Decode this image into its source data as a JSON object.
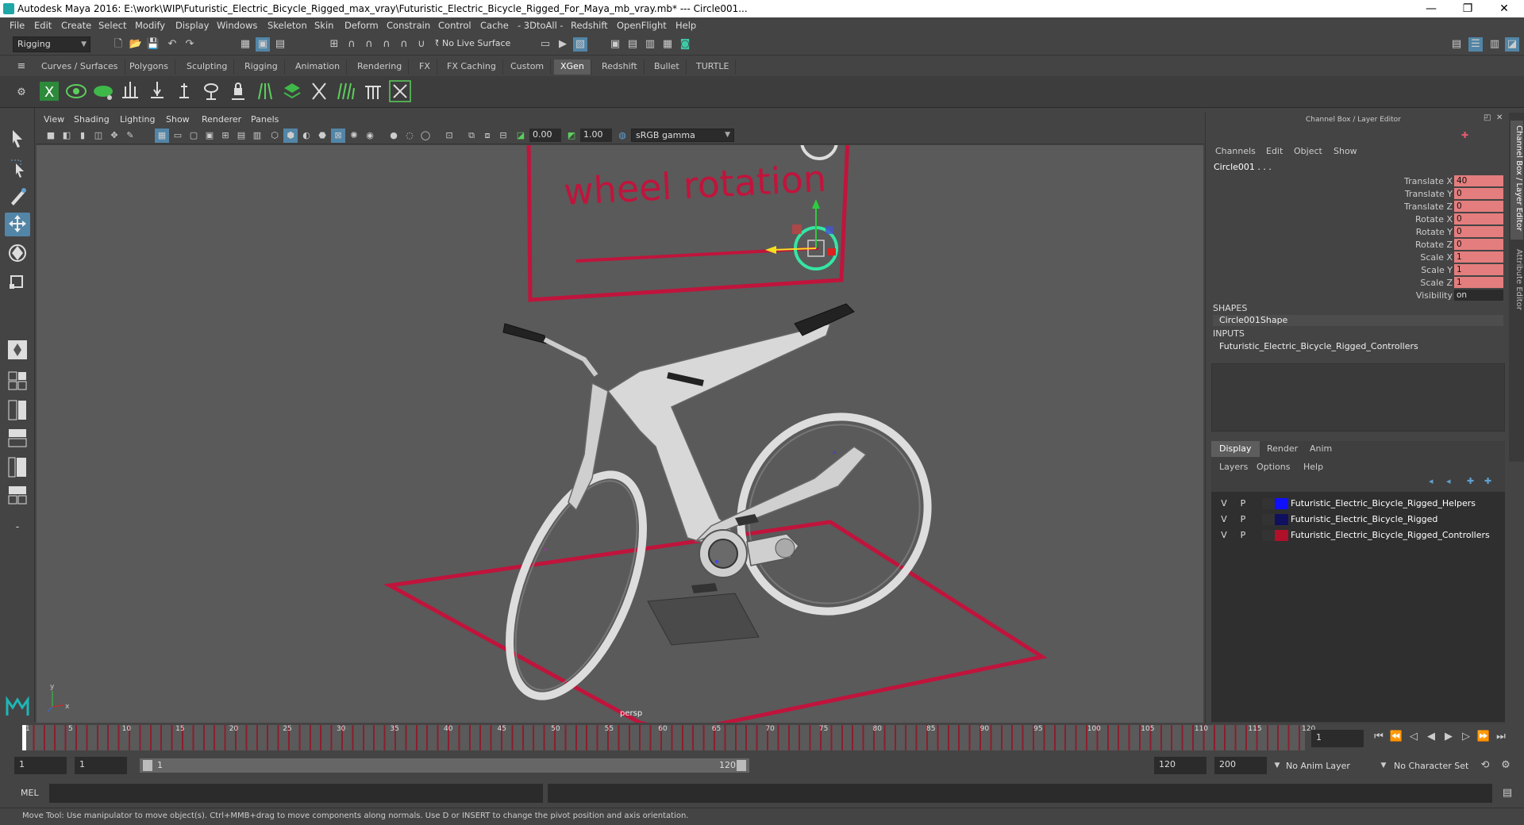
{
  "window": {
    "title": "Autodesk Maya 2016: E:\\work\\WIP\\Futuristic_Electric_Bicycle_Rigged_max_vray\\Futuristic_Electric_Bicycle_Rigged_For_Maya_mb_vray.mb*   ---   Circle001...",
    "minimize": "—",
    "restore": "❐",
    "close": "✕"
  },
  "menubar": [
    "File",
    "Edit",
    "Create",
    "Select",
    "Modify",
    "Display",
    "Windows",
    "Skeleton",
    "Skin",
    "Deform",
    "Constrain",
    "Control",
    "Cache",
    "- 3DtoAll -",
    "Redshift",
    "OpenFlight",
    "Help"
  ],
  "status_line": {
    "mode": "Rigging",
    "live_surface": "No Live Surface"
  },
  "shelf_tabs": [
    "Curves / Surfaces",
    "Polygons",
    "Sculpting",
    "Rigging",
    "Animation",
    "Rendering",
    "FX",
    "FX Caching",
    "Custom",
    "XGen",
    "Redshift",
    "Bullet",
    "TURTLE"
  ],
  "shelf_active": "XGen",
  "viewport": {
    "menus": [
      "View",
      "Shading",
      "Lighting",
      "Show",
      "Renderer",
      "Panels"
    ],
    "field_a": "0.00",
    "field_b": "1.00",
    "color_space": "sRGB gamma",
    "camera_label": "persp",
    "scene_text": "wheel rotation",
    "axis_y": "y",
    "axis_x": "x"
  },
  "channel_box": {
    "header": "Channel Box / Layer Editor",
    "menus": [
      "Channels",
      "Edit",
      "Object",
      "Show"
    ],
    "object": "Circle001 . . .",
    "attributes": [
      {
        "name": "Translate X",
        "value": "40"
      },
      {
        "name": "Translate Y",
        "value": "0"
      },
      {
        "name": "Translate Z",
        "value": "0"
      },
      {
        "name": "Rotate X",
        "value": "0"
      },
      {
        "name": "Rotate Y",
        "value": "0"
      },
      {
        "name": "Rotate Z",
        "value": "0"
      },
      {
        "name": "Scale X",
        "value": "1"
      },
      {
        "name": "Scale Y",
        "value": "1"
      },
      {
        "name": "Scale Z",
        "value": "1"
      },
      {
        "name": "Visibility",
        "value": "on"
      }
    ],
    "shapes_label": "SHAPES",
    "shape": "Circle001Shape",
    "inputs_label": "INPUTS",
    "input": "Futuristic_Electric_Bicycle_Rigged_Controllers",
    "side_tab_1": "Channel Box / Layer Editor",
    "side_tab_2": "Attribute Editor"
  },
  "layer_editor": {
    "tabs": [
      "Display",
      "Render",
      "Anim"
    ],
    "active_tab": "Display",
    "menus": [
      "Layers",
      "Options",
      "Help"
    ],
    "layers": [
      {
        "v": "V",
        "p": "P",
        "color": "#1010ff",
        "name": "Futuristic_Electric_Bicycle_Rigged_Helpers"
      },
      {
        "v": "V",
        "p": "P",
        "color": "#101060",
        "name": "Futuristic_Electric_Bicycle_Rigged"
      },
      {
        "v": "V",
        "p": "P",
        "color": "#b0102a",
        "name": "Futuristic_Electric_Bicycle_Rigged_Controllers"
      }
    ]
  },
  "timeline": {
    "ticks": [
      "1",
      "5",
      "10",
      "15",
      "20",
      "25",
      "30",
      "35",
      "40",
      "45",
      "50",
      "55",
      "60",
      "65",
      "70",
      "75",
      "80",
      "85",
      "90",
      "95",
      "100",
      "105",
      "110",
      "115",
      "120"
    ],
    "current_frame": "1",
    "range_start": "1",
    "range_start2": "1",
    "slider_start": "1",
    "slider_end": "120",
    "range_end": "120",
    "anim_end": "200",
    "anim_layer": "No Anim Layer",
    "character_set": "No Character Set"
  },
  "command_line": {
    "label": "MEL"
  },
  "help_line": "Move Tool: Use manipulator to move object(s). Ctrl+MMB+drag to move components along normals. Use D or INSERT to change the pivot position and axis orientation.",
  "colors": {
    "accent": "#5285a6",
    "channel_value": "#e47d7d",
    "controller_red": "#c0143c"
  }
}
